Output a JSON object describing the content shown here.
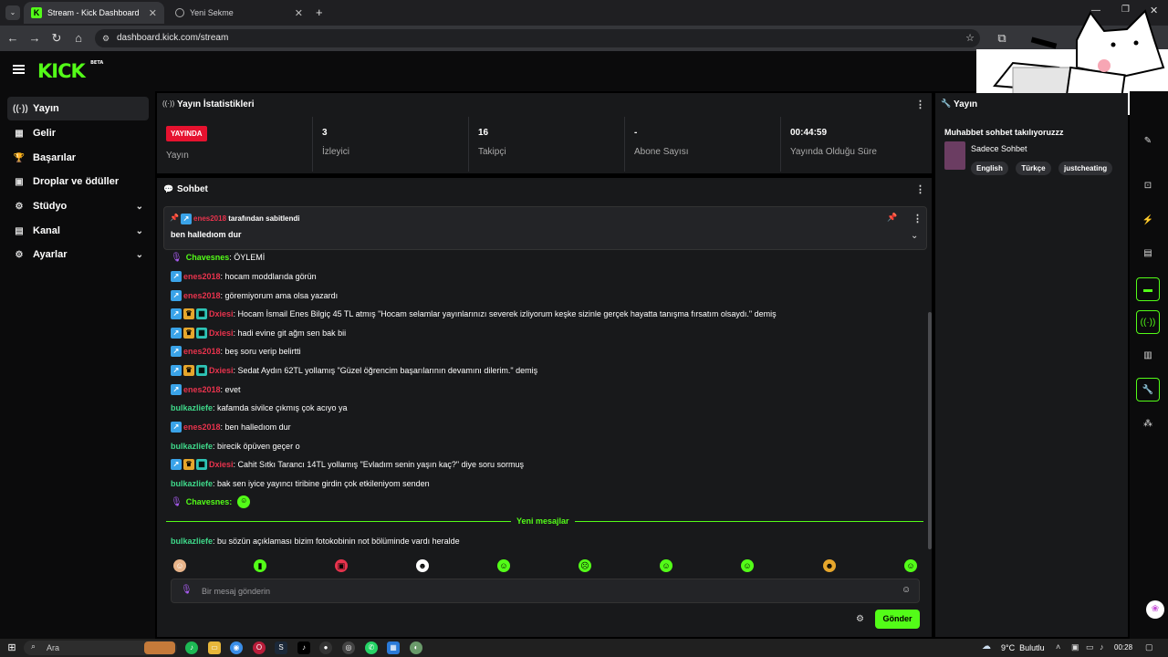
{
  "browser": {
    "tabs": [
      {
        "label": "Stream - Kick Dashboard",
        "active": true
      },
      {
        "label": "Yeni Sekme",
        "active": false
      }
    ],
    "url": "dashboard.kick.com/stream"
  },
  "header": {
    "logo": "KICK",
    "logo_sup": "BETA"
  },
  "sidebar": {
    "items": [
      {
        "label": "Yayın",
        "icon": "broadcast-icon",
        "active": true
      },
      {
        "label": "Gelir",
        "icon": "revenue-icon"
      },
      {
        "label": "Başarılar",
        "icon": "trophy-icon"
      },
      {
        "label": "Droplar ve ödüller",
        "icon": "gift-icon"
      },
      {
        "label": "Stüdyo",
        "icon": "studio-icon",
        "expandable": true
      },
      {
        "label": "Kanal",
        "icon": "channel-icon",
        "expandable": true
      },
      {
        "label": "Ayarlar",
        "icon": "gear-icon",
        "expandable": true
      }
    ]
  },
  "stats": {
    "title": "Yayın İstatistikleri",
    "live_badge": "YAYINDA",
    "items": [
      {
        "value": "",
        "label": "Yayın"
      },
      {
        "value": "3",
        "label": "İzleyici"
      },
      {
        "value": "16",
        "label": "Takipçi"
      },
      {
        "value": "-",
        "label": "Abone Sayısı"
      },
      {
        "value": "00:44:59",
        "label": "Yayında Olduğu Süre"
      }
    ]
  },
  "chat": {
    "title": "Sohbet",
    "pinned": {
      "by_user": "enes2018",
      "by_text": "tarafından sabitlendi",
      "message": "ben halledıom dur"
    },
    "messages": [
      {
        "user": "Chavesnes",
        "text": ": ÖYLEMİ",
        "badges": [
          "mic"
        ],
        "color": "green"
      },
      {
        "user": "enes2018",
        "text": ": hocam moddlarıda görün",
        "badges": [
          "blue"
        ],
        "color": "red"
      },
      {
        "user": "enes2018",
        "text": ": göremiyorum ama olsa yazardı",
        "badges": [
          "blue"
        ],
        "color": "red"
      },
      {
        "user": "Dxiesi",
        "text": ": Hocam İsmail Enes Bilgiç 45 TL atmış \"Hocam selamlar yayınlarınızı severek izliyorum keşke sizinle gerçek hayatta tanışma fırsatım olsaydı.\" demiş",
        "badges": [
          "blue",
          "gold",
          "teal"
        ],
        "color": "red"
      },
      {
        "user": "Dxiesi",
        "text": ": hadi evine git ağm sen bak bii",
        "badges": [
          "blue",
          "gold",
          "teal"
        ],
        "color": "red"
      },
      {
        "user": "enes2018",
        "text": ": beş soru verip belirtti",
        "badges": [
          "blue"
        ],
        "color": "red"
      },
      {
        "user": "Dxiesi",
        "text": ": Sedat Aydın 62TL yollamış \"Güzel öğrencim başarılarının devamını dilerim.\" demiş",
        "badges": [
          "blue",
          "gold",
          "teal"
        ],
        "color": "red"
      },
      {
        "user": "enes2018",
        "text": ": evet",
        "badges": [
          "blue"
        ],
        "color": "red"
      },
      {
        "user": "bulkazliefe",
        "text": ": kafamda sivilce çıkmış çok acıyo ya",
        "badges": [],
        "color": "green2"
      },
      {
        "user": "enes2018",
        "text": ": ben halledıom dur",
        "badges": [
          "blue"
        ],
        "color": "red"
      },
      {
        "user": "bulkazliefe",
        "text": ": birecik öpüven geçer o",
        "badges": [],
        "color": "green2"
      },
      {
        "user": "Dxiesi",
        "text": ": Cahit Sıtkı Tarancı 14TL yollamış \"Evladım senin yaşın kaç?\" diye soru sormuş",
        "badges": [
          "blue",
          "gold",
          "teal"
        ],
        "color": "red"
      },
      {
        "user": "bulkazliefe",
        "text": ": bak sen iyice yayıncı tiribine girdin çok etkileniyom senden",
        "badges": [],
        "color": "green2"
      },
      {
        "user": "Chavesnes",
        "text": ":",
        "badges": [
          "mic"
        ],
        "color": "green"
      }
    ],
    "new_messages_label": "Yeni mesajlar",
    "after_new": {
      "user": "bulkazliefe",
      "text": ": bu sözün açıklaması bizim fotokobinin not bölüminde vardı heralde"
    },
    "input_placeholder": "Bir mesaj gönderin",
    "send_label": "Gönder"
  },
  "right_panel": {
    "title": "Yayın",
    "stream_title": "Muhabbet sohbet takılıyoruzzz",
    "category": "Sadece Sohbet",
    "tags": [
      "English",
      "Türkçe",
      "justcheating"
    ]
  },
  "taskbar": {
    "search": "Ara",
    "weather": "9°C  Bulutlu",
    "time": "00:28"
  },
  "colors": {
    "accent": "#53fc18",
    "live": "#e6122f",
    "username_red": "#e8334d"
  }
}
